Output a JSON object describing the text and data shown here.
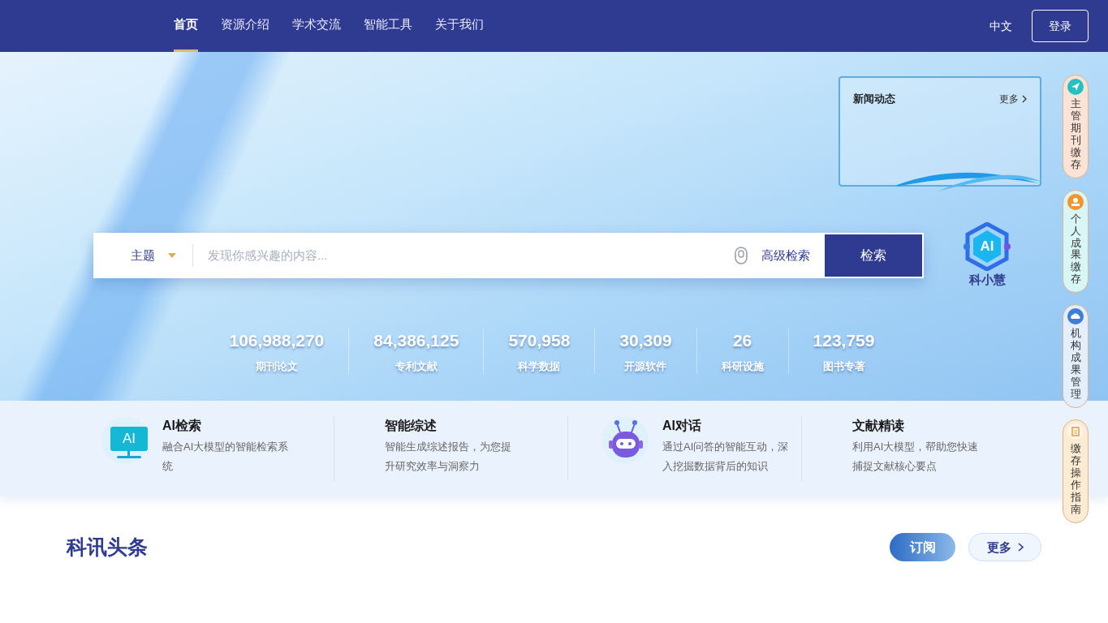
{
  "nav": {
    "items": [
      {
        "label": "首页",
        "selected": true
      },
      {
        "label": "资源介绍",
        "selected": false
      },
      {
        "label": "学术交流",
        "selected": false
      },
      {
        "label": "智能工具",
        "selected": false
      },
      {
        "label": "关于我们",
        "selected": false
      }
    ],
    "language": "中文",
    "login": "登录"
  },
  "news_panel": {
    "title": "新闻动态",
    "more": "更多"
  },
  "search": {
    "scope": "主题",
    "placeholder": "发现你感兴趣的内容...",
    "advanced": "高级检索",
    "button": "检索"
  },
  "assistant": {
    "badge": "AI",
    "name": "科小慧"
  },
  "stats": [
    {
      "value": "106,988,270",
      "label": "期刊论文"
    },
    {
      "value": "84,386,125",
      "label": "专利文献"
    },
    {
      "value": "570,958",
      "label": "科学数据"
    },
    {
      "value": "30,309",
      "label": "开源软件"
    },
    {
      "value": "26",
      "label": "科研设施"
    },
    {
      "value": "123,759",
      "label": "图书专著"
    }
  ],
  "features": [
    {
      "kind": "monitor",
      "icon_text": "AI",
      "title": "AI检索",
      "desc": "融合AI大模型的智能检索系统"
    },
    {
      "kind": "none",
      "title": "智能综述",
      "desc": "智能生成综述报告，为您提升研究效率与洞察力"
    },
    {
      "kind": "robot",
      "title": "AI对话",
      "desc": "通过AI问答的智能互动，深入挖掘数据背后的知识"
    },
    {
      "kind": "none",
      "title": "文献精读",
      "desc": "利用AI大模型，帮助您快速捕捉文献核心要点"
    }
  ],
  "side_tabs": [
    {
      "label": "主管期刊缴存",
      "kind": "send",
      "color": "#fde3d6"
    },
    {
      "label": "个人成果缴存",
      "kind": "person",
      "color": "#d8f6f6"
    },
    {
      "label": "机构成果管理",
      "kind": "cloud",
      "color": "#e3effc"
    },
    {
      "label": "缴存操作指南",
      "kind": "doc",
      "color": "#fdebd3"
    }
  ],
  "headlines": {
    "title": "科讯头条",
    "subscribe": "订阅",
    "more": "更多"
  }
}
